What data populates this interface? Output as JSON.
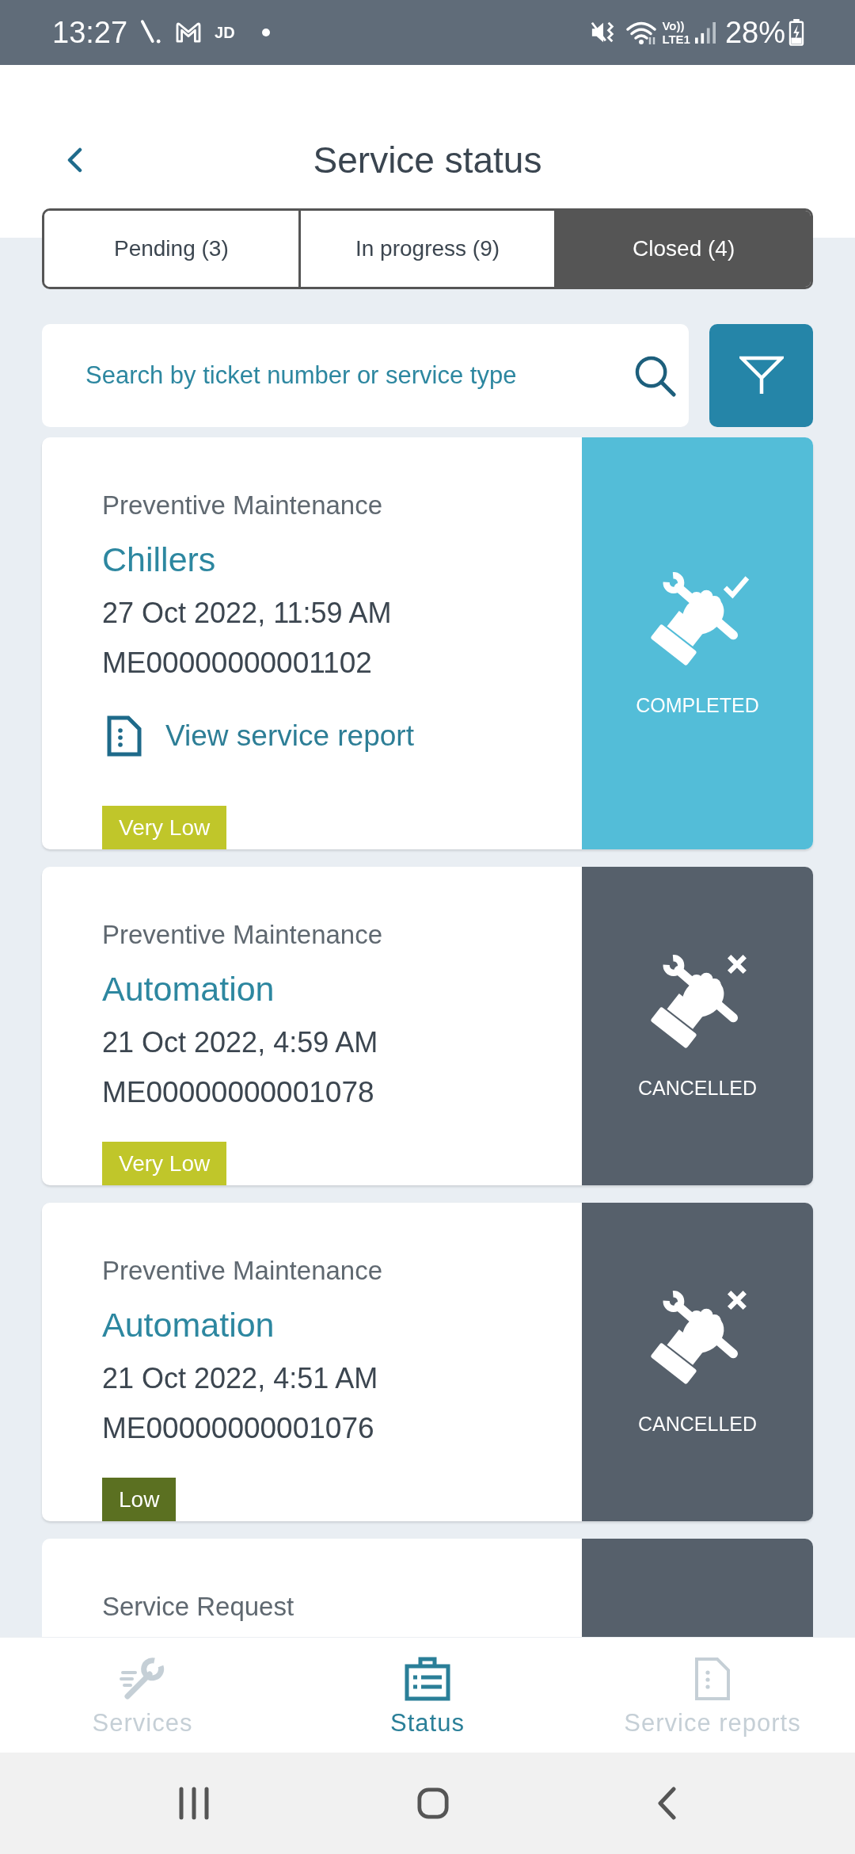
{
  "status_bar": {
    "time": "13:27",
    "app_label": "JD",
    "volte_label": "Vo))",
    "network_label": "LTE1",
    "battery": "28%"
  },
  "header": {
    "title": "Service status"
  },
  "tabs": [
    {
      "label": "Pending (3)",
      "selected": false
    },
    {
      "label": "In progress (9)",
      "selected": false
    },
    {
      "label": "Closed (4)",
      "selected": true
    }
  ],
  "search": {
    "placeholder": "Search by ticket number or service type"
  },
  "tickets": [
    {
      "category": "Preventive Maintenance",
      "title": "Chillers",
      "date": "27 Oct 2022, 11:59 AM",
      "number": "ME00000000001102",
      "report_link": "View service report",
      "priority": {
        "label": "Very Low",
        "color": "#c0c62a"
      },
      "status": {
        "kind": "completed",
        "label": "COMPLETED"
      }
    },
    {
      "category": "Preventive Maintenance",
      "title": "Automation",
      "date": "21 Oct 2022, 4:59 AM",
      "number": "ME00000000001078",
      "priority": {
        "label": "Very Low",
        "color": "#c0c62a"
      },
      "status": {
        "kind": "cancelled",
        "label": "CANCELLED"
      }
    },
    {
      "category": "Preventive Maintenance",
      "title": "Automation",
      "date": "21 Oct 2022, 4:51 AM",
      "number": "ME00000000001076",
      "priority": {
        "label": "Low",
        "color": "#5b7021"
      },
      "status": {
        "kind": "cancelled",
        "label": "CANCELLED"
      }
    },
    {
      "category": "Service Request",
      "status": {
        "kind": "cancelled"
      }
    }
  ],
  "bottom_nav": [
    {
      "label": "Services",
      "selected": false
    },
    {
      "label": "Status",
      "selected": true
    },
    {
      "label": "Service reports",
      "selected": false
    }
  ]
}
